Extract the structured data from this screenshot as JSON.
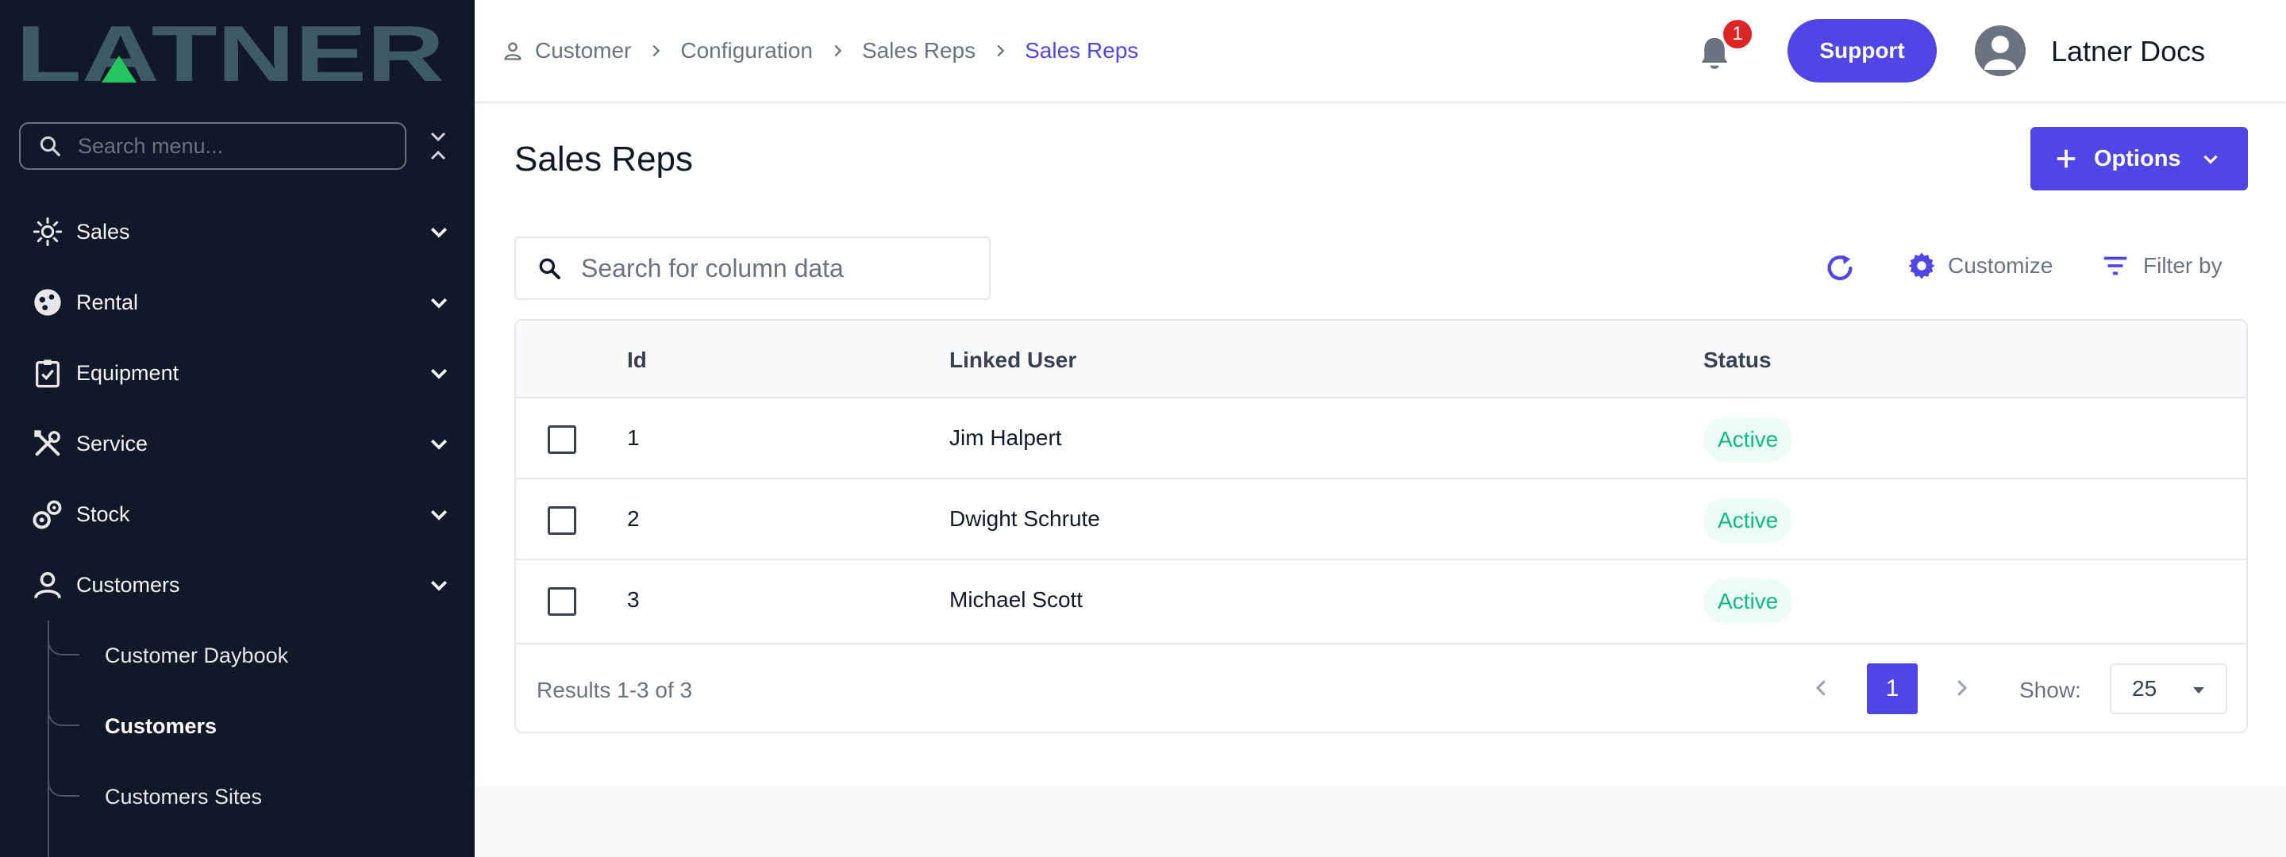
{
  "brand": {
    "name": "LATNER"
  },
  "sidebar": {
    "search_placeholder": "Search menu...",
    "items": [
      {
        "label": "Sales",
        "icon": "sales-icon"
      },
      {
        "label": "Rental",
        "icon": "rental-icon"
      },
      {
        "label": "Equipment",
        "icon": "clipboard-icon"
      },
      {
        "label": "Service",
        "icon": "tools-icon"
      },
      {
        "label": "Stock",
        "icon": "gears-icon"
      },
      {
        "label": "Customers",
        "icon": "user-icon"
      }
    ],
    "sub_items": [
      {
        "label": "Customer Daybook",
        "active": false
      },
      {
        "label": "Customers",
        "active": true
      },
      {
        "label": "Customers Sites",
        "active": false
      }
    ]
  },
  "header": {
    "breadcrumb": [
      "Customer",
      "Configuration",
      "Sales Reps",
      "Sales Reps"
    ],
    "notifications_count": "1",
    "support_label": "Support",
    "user_name": "Latner Docs"
  },
  "main": {
    "title": "Sales Reps",
    "options_label": "Options",
    "search_placeholder": "Search for column data",
    "customize_label": "Customize",
    "filter_label": "Filter by",
    "columns": [
      "Id",
      "Linked User",
      "Status"
    ],
    "rows": [
      {
        "id": "1",
        "user": "Jim Halpert",
        "status": "Active"
      },
      {
        "id": "2",
        "user": "Dwight Schrute",
        "status": "Active"
      },
      {
        "id": "3",
        "user": "Michael Scott",
        "status": "Active"
      }
    ],
    "results_text": "Results 1-3 of 3",
    "current_page": "1",
    "show_label": "Show:",
    "page_size": "25"
  },
  "colors": {
    "accent": "#4f46e5",
    "sidebar_bg": "#111827",
    "active_green": "#10b981",
    "badge_red": "#dc2626"
  }
}
